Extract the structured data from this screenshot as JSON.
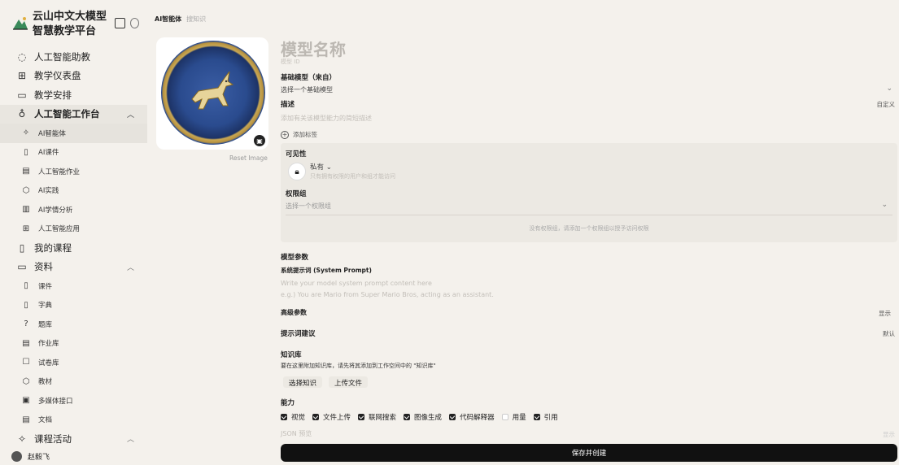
{
  "brand": {
    "title": "云山中文大模型智慧教学平台"
  },
  "sidebar": {
    "items": [
      {
        "label": "人工智能助教",
        "icon": "chat-bubble-icon",
        "level": 0
      },
      {
        "label": "教学仪表盘",
        "icon": "grid-icon",
        "level": 0
      },
      {
        "label": "教学安排",
        "icon": "calendar-icon",
        "level": 0
      },
      {
        "label": "人工智能工作台",
        "icon": "bulb-icon",
        "level": 0,
        "expanded": true,
        "active_parent": true
      },
      {
        "label": "AI智能体",
        "icon": "sparkle-icon",
        "level": 1,
        "active": true
      },
      {
        "label": "AI课件",
        "icon": "book-icon",
        "level": 1
      },
      {
        "label": "人工智能作业",
        "icon": "doc-icon",
        "level": 1
      },
      {
        "label": "AI实践",
        "icon": "cube-icon",
        "level": 1
      },
      {
        "label": "AI学情分析",
        "icon": "bar-chart-icon",
        "level": 1
      },
      {
        "label": "人工智能应用",
        "icon": "apps-icon",
        "level": 1
      },
      {
        "label": "我的课程",
        "icon": "book-icon",
        "level": 0
      },
      {
        "label": "资料",
        "icon": "folder-icon",
        "level": 0,
        "expanded": true
      },
      {
        "label": "课件",
        "icon": "book-icon",
        "level": 1
      },
      {
        "label": "字典",
        "icon": "book-icon",
        "level": 1
      },
      {
        "label": "题库",
        "icon": "question-icon",
        "level": 1
      },
      {
        "label": "作业库",
        "icon": "doc-icon",
        "level": 1
      },
      {
        "label": "试卷库",
        "icon": "paper-icon",
        "level": 1
      },
      {
        "label": "教材",
        "icon": "cube-icon",
        "level": 1
      },
      {
        "label": "多媒体接口",
        "icon": "image-icon",
        "level": 1
      },
      {
        "label": "文档",
        "icon": "doc-icon",
        "level": 1
      },
      {
        "label": "课程活动",
        "icon": "sparkle-icon",
        "level": 0,
        "expanded": true
      }
    ],
    "user_name": "赵毅飞"
  },
  "tabs": {
    "active": "AI智能体",
    "inactive": "搜知识"
  },
  "image_card": {
    "reset_label": "Reset Image"
  },
  "form": {
    "model_name_placeholder": "模型名称",
    "model_id_placeholder": "模型 ID",
    "base_model_label": "基础模型（来自）",
    "base_model_placeholder": "选择一个基础模型",
    "description_label": "描述",
    "description_action": "自定义",
    "description_placeholder": "添加有关该模型能力的简短描述",
    "add_tag_label": "添加标签",
    "visibility_label": "可见性",
    "visibility_value": "私有",
    "visibility_hint": "只有拥有权限的用户和组才能访问",
    "perm_group_label": "权限组",
    "perm_group_placeholder": "选择一个权限组",
    "perm_empty_hint": "没有权限组，请添加一个权限组以授予访问权限",
    "params_label": "模型参数",
    "system_prompt_label": "系统提示词 (System Prompt)",
    "system_prompt_placeholder_1": "Write your model system prompt content here",
    "system_prompt_placeholder_2": "e.g.) You are Mario from Super Mario Bros, acting as an assistant.",
    "advanced_label": "高级参数",
    "advanced_action": "显示",
    "prompt_suggest_label": "提示词建议",
    "prompt_suggest_action": "默认",
    "knowledge_label": "知识库",
    "knowledge_hint": "要在这里附加知识库，请先将其添加到工作空间中的 \"知识库\"",
    "select_knowledge_button": "选择知识",
    "upload_file_button": "上传文件",
    "capabilities_label": "能力",
    "capabilities": [
      {
        "label": "视觉",
        "checked": true
      },
      {
        "label": "文件上传",
        "checked": true
      },
      {
        "label": "联网搜索",
        "checked": true
      },
      {
        "label": "图像生成",
        "checked": true
      },
      {
        "label": "代码解释器",
        "checked": true
      },
      {
        "label": "用量",
        "checked": false
      },
      {
        "label": "引用",
        "checked": true
      }
    ],
    "json_preview_label": "JSON 预览",
    "json_preview_action": "显示",
    "save_button": "保存并创建"
  }
}
